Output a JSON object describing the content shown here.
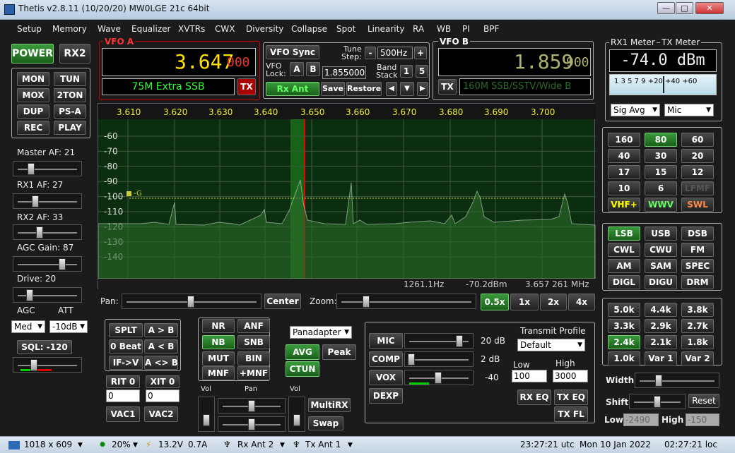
{
  "window": {
    "title": "Thetis v2.8.11 (10/20/20) MW0LGE 21c 64bit",
    "min": "—",
    "max": "□",
    "close": "✕"
  },
  "menu": [
    "Setup",
    "Memory",
    "Wave",
    "Equalizer",
    "XVTRs",
    "CWX",
    "Diversity",
    "Collapse",
    "Spot",
    "Linearity",
    "RA",
    "WB",
    "PI",
    "BPF"
  ],
  "left": {
    "power": "POWER",
    "rx2": "RX2",
    "mon": "MON",
    "tun": "TUN",
    "mox": "MOX",
    "twoton": "2TON",
    "dup": "DUP",
    "psa": "PS-A",
    "rec": "REC",
    "play": "PLAY",
    "master_af": "Master AF:  21",
    "rx1_af": "RX1 AF:  27",
    "rx2_af": "RX2 AF:  33",
    "agc_gain": "AGC Gain:  87",
    "drive": "Drive:  20",
    "agc": "AGC",
    "att": "ATT",
    "agc_val": "Med",
    "att_val": "-10dB",
    "sql": "SQL:  -120"
  },
  "vfoa": {
    "label": "VFO A",
    "freq": "3.647",
    "sub": "000",
    "mode": "75M Extra SSB",
    "tx": "TX"
  },
  "center": {
    "vfo_sync": "VFO Sync",
    "tune_step": "Tune\nStep:",
    "step_val": "500Hz",
    "minus": "-",
    "plus": "+",
    "vfo_lock": "VFO\nLock:",
    "a": "A",
    "b": "B",
    "lock_freq": "1.855000",
    "band_stack": "Band\nStack",
    "bs1": "1",
    "bs5": "5",
    "rx_ant": "Rx Ant",
    "save": "Save",
    "restore": "Restore"
  },
  "vfob": {
    "label": "VFO B",
    "freq": "1.859",
    "sub": "900",
    "tx": "TX",
    "mode": "160M SSB/SSTV/Wide B"
  },
  "meter": {
    "rx1": "RX1 Meter",
    "tx": "TX Meter",
    "value": "-74.0 dBm",
    "scale": "1 3 5 7 9 +20 +40 +60",
    "sig": "Sig Avg",
    "mic": "Mic"
  },
  "pan": {
    "freq_labels": [
      "3.610",
      "3.620",
      "3.630",
      "3.640",
      "3.650",
      "3.660",
      "3.670",
      "3.680",
      "3.690",
      "3.700"
    ],
    "db_labels": [
      "-60",
      "-70",
      "-80",
      "-90",
      "-100",
      "-110",
      "-120",
      "-130",
      "-140"
    ],
    "marker": "-G",
    "status_hz": "1261.1Hz",
    "status_dbm": "-70.2dBm",
    "status_mhz": "3.657 261 MHz"
  },
  "bands": [
    "160",
    "80",
    "60",
    "40",
    "30",
    "20",
    "17",
    "15",
    "12",
    "10",
    "6",
    "LFMF",
    "VHF+",
    "WWV",
    "SWL"
  ],
  "modes": [
    "LSB",
    "USB",
    "DSB",
    "CWL",
    "CWU",
    "FM",
    "AM",
    "SAM",
    "SPEC",
    "DIGL",
    "DIGU",
    "DRM"
  ],
  "filters": [
    "5.0k",
    "4.4k",
    "3.8k",
    "3.3k",
    "2.9k",
    "2.7k",
    "2.4k",
    "2.1k",
    "1.8k",
    "1.0k",
    "Var 1",
    "Var 2"
  ],
  "filter_ctl": {
    "width": "Width:",
    "shift": "Shift:",
    "reset": "Reset",
    "low": "Low",
    "low_val": "-2490",
    "high": "High",
    "high_val": "-150"
  },
  "panbar": {
    "pan": "Pan:",
    "center": "Center",
    "zoom": "Zoom:",
    "z05": "0.5x",
    "z1": "1x",
    "z2": "2x",
    "z4": "4x"
  },
  "vfo_ops": {
    "split": "SPLT",
    "a2b": "A > B",
    "zerobeat": "0 Beat",
    "b2a": "A < B",
    "ifv": "IF->V",
    "swap": "A <> B",
    "rit": "RIT",
    "rit_v": "0",
    "xit": "XIT",
    "xit_v": "0",
    "rit_val": "0",
    "xit_val": "0",
    "vac1": "VAC1",
    "vac2": "VAC2"
  },
  "dsp": {
    "nr": "NR",
    "anf": "ANF",
    "nb": "NB",
    "snb": "SNB",
    "mut": "MUT",
    "bin": "BIN",
    "mnf": "MNF",
    "pmnf": "+MNF",
    "vol": "Vol",
    "pan": "Pan",
    "vol2": "Vol",
    "multirx": "MultiRX",
    "swap": "Swap"
  },
  "display": {
    "mode": "Panadapter",
    "avg": "AVG",
    "peak": "Peak",
    "ctun": "CTUN"
  },
  "tx": {
    "mic": "MIC",
    "mic_db": "20 dB",
    "comp": "COMP",
    "comp_db": "2 dB",
    "vox": "VOX",
    "vox_val": "-40",
    "dexp": "DEXP",
    "profile_lbl": "Transmit Profile",
    "profile": "Default",
    "low": "Low",
    "low_val": "100",
    "high": "High",
    "high_val": "3000",
    "rxeq": "RX EQ",
    "txeq": "TX EQ",
    "txfl": "TX FL"
  },
  "status": {
    "res": "1018 x 609",
    "cpu": "20%",
    "volt": "13.2V",
    "amp": "0.7A",
    "rxant": "Rx Ant 2",
    "txant": "Tx Ant 1",
    "utc": "23:27:21 utc",
    "date": "Mon 10 Jan 2022",
    "local": "02:27:21 loc"
  },
  "colors": {
    "accent_green": "#2a8a2a",
    "lcd_yellow": "#ffe000",
    "lcd_dim": "#b0b070",
    "mode_green": "#3f3",
    "tx_red": "#c00",
    "pan_bg": "#0c2e10"
  }
}
